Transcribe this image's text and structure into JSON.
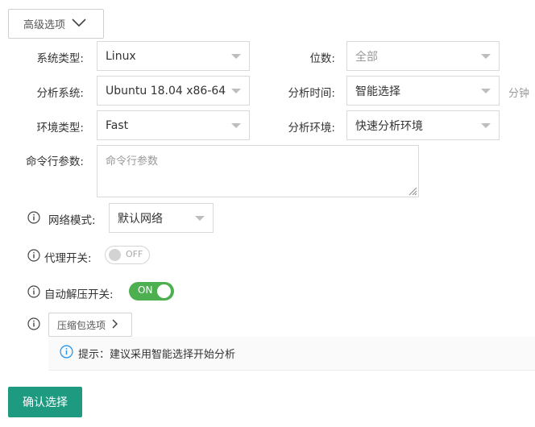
{
  "advanced": {
    "label": "高级选项"
  },
  "form": {
    "os_type": {
      "label": "系统类型:",
      "value": "Linux"
    },
    "bits": {
      "label": "位数:",
      "value": "全部"
    },
    "analysis_system": {
      "label": "分析系统:",
      "value": "Ubuntu 18.04 x86-64"
    },
    "analysis_time": {
      "label": "分析时间:",
      "value": "智能选择",
      "unit": "分钟"
    },
    "env_type": {
      "label": "环境类型:",
      "value": "Fast"
    },
    "analysis_env": {
      "label": "分析环境:",
      "value": "快速分析环境"
    },
    "cmdline": {
      "label": "命令行参数:",
      "placeholder": "命令行参数"
    },
    "network": {
      "label": "网络模式:",
      "value": "默认网络"
    },
    "proxy": {
      "label": "代理开关:",
      "state": "OFF"
    },
    "auto_unzip": {
      "label": "自动解压开关:",
      "state": "ON"
    },
    "compress": {
      "label": "压缩包选项"
    },
    "hint": {
      "text": "提示：建议采用智能选择开始分析"
    }
  },
  "confirm": {
    "label": "确认选择"
  },
  "colors": {
    "primary": "#1e9a80",
    "toggle_on": "#4caf50",
    "info": "#2196f3"
  },
  "icons": [
    "chevron-down-icon",
    "caret-down-icon",
    "info-icon",
    "chevron-right-icon",
    "resize-grip-icon"
  ]
}
